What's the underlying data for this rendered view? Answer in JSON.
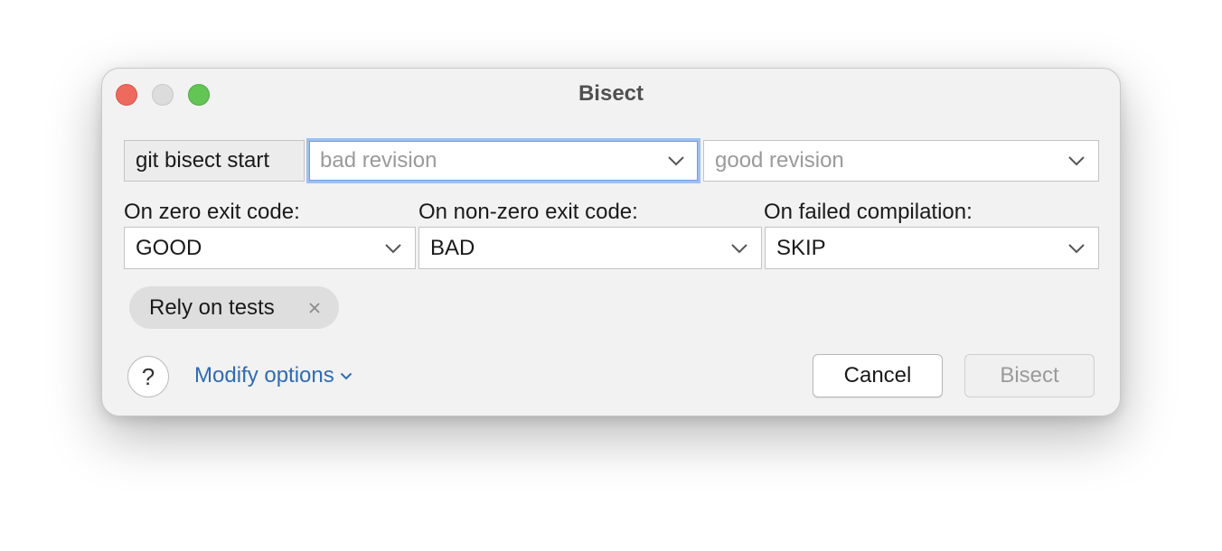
{
  "window": {
    "title": "Bisect"
  },
  "command": {
    "prefix": "git bisect start",
    "bad_revision": {
      "value": "",
      "placeholder": "bad revision"
    },
    "good_revision": {
      "value": "",
      "placeholder": "good revision"
    }
  },
  "exit_codes": {
    "zero": {
      "label": "On zero exit code:",
      "selected": "GOOD"
    },
    "non_zero": {
      "label": "On non-zero exit code:",
      "selected": "BAD"
    },
    "failed_compilation": {
      "label": "On failed compilation:",
      "selected": "SKIP"
    }
  },
  "options": {
    "chips": [
      {
        "label": "Rely on tests"
      }
    ],
    "modify_label": "Modify options"
  },
  "footer": {
    "help_glyph": "?",
    "cancel_label": "Cancel",
    "submit_label": "Bisect"
  },
  "colors": {
    "close": "#ee6a5e",
    "minimize": "#dcdcdc",
    "maximize": "#62c554",
    "focus_ring": "#9ec0ed",
    "link": "#2f6bb6"
  },
  "icons": [
    "close-icon",
    "chevron-down-icon",
    "question-icon"
  ]
}
